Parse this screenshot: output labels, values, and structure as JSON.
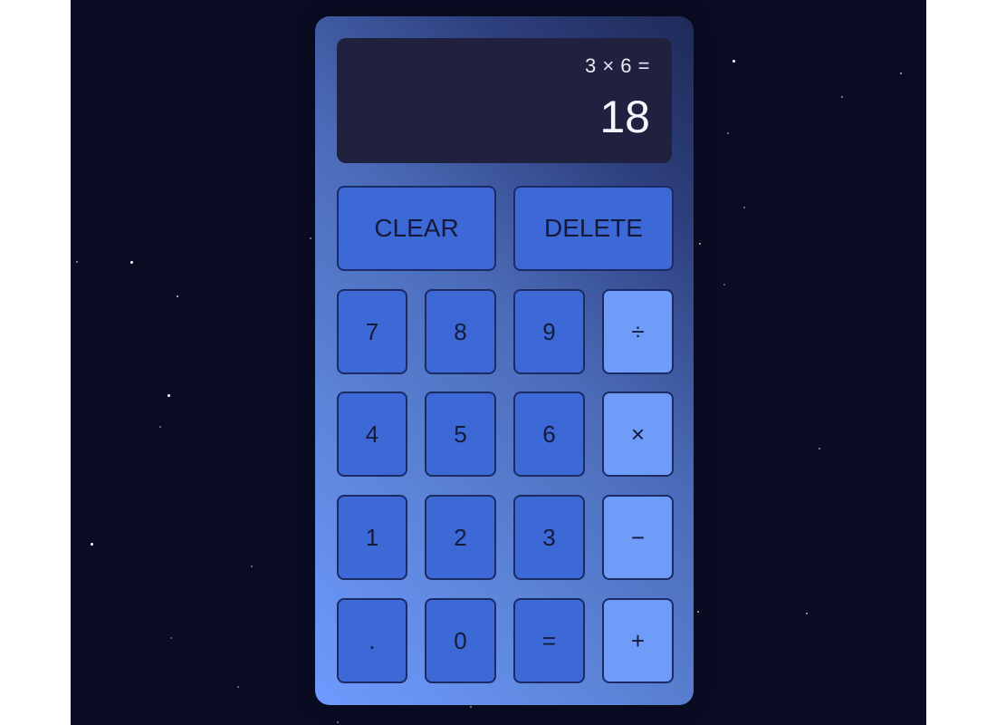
{
  "display": {
    "expression": "3 × 6 =",
    "result": "18"
  },
  "actions": {
    "clear_label": "CLEAR",
    "delete_label": "DELETE"
  },
  "keypad": {
    "seven": "7",
    "eight": "8",
    "nine": "9",
    "divide": "÷",
    "four": "4",
    "five": "5",
    "six": "6",
    "multiply": "×",
    "one": "1",
    "two": "2",
    "three": "3",
    "subtract": "−",
    "decimal": ".",
    "zero": "0",
    "equals": "=",
    "add": "+"
  },
  "colors": {
    "background": "#0a0c24",
    "display_bg": "#20213f",
    "key": "#3d69d6",
    "operator_key": "#6e9cf8",
    "key_border": "#1c2a66"
  }
}
